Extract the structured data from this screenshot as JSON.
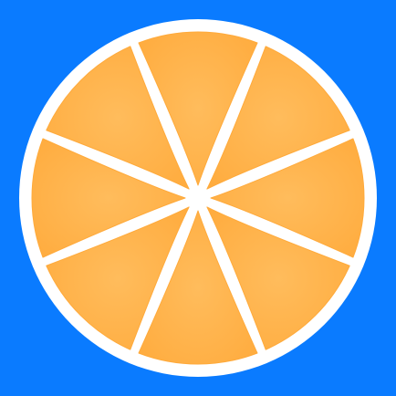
{
  "icon": {
    "name": "orange-slice-icon",
    "background_color": "#0A7BFF",
    "rind_color": "#FFFFFF",
    "segment_color": "#FFAA3B",
    "segment_highlight_color": "#FFBC5C",
    "segment_count": 8
  }
}
